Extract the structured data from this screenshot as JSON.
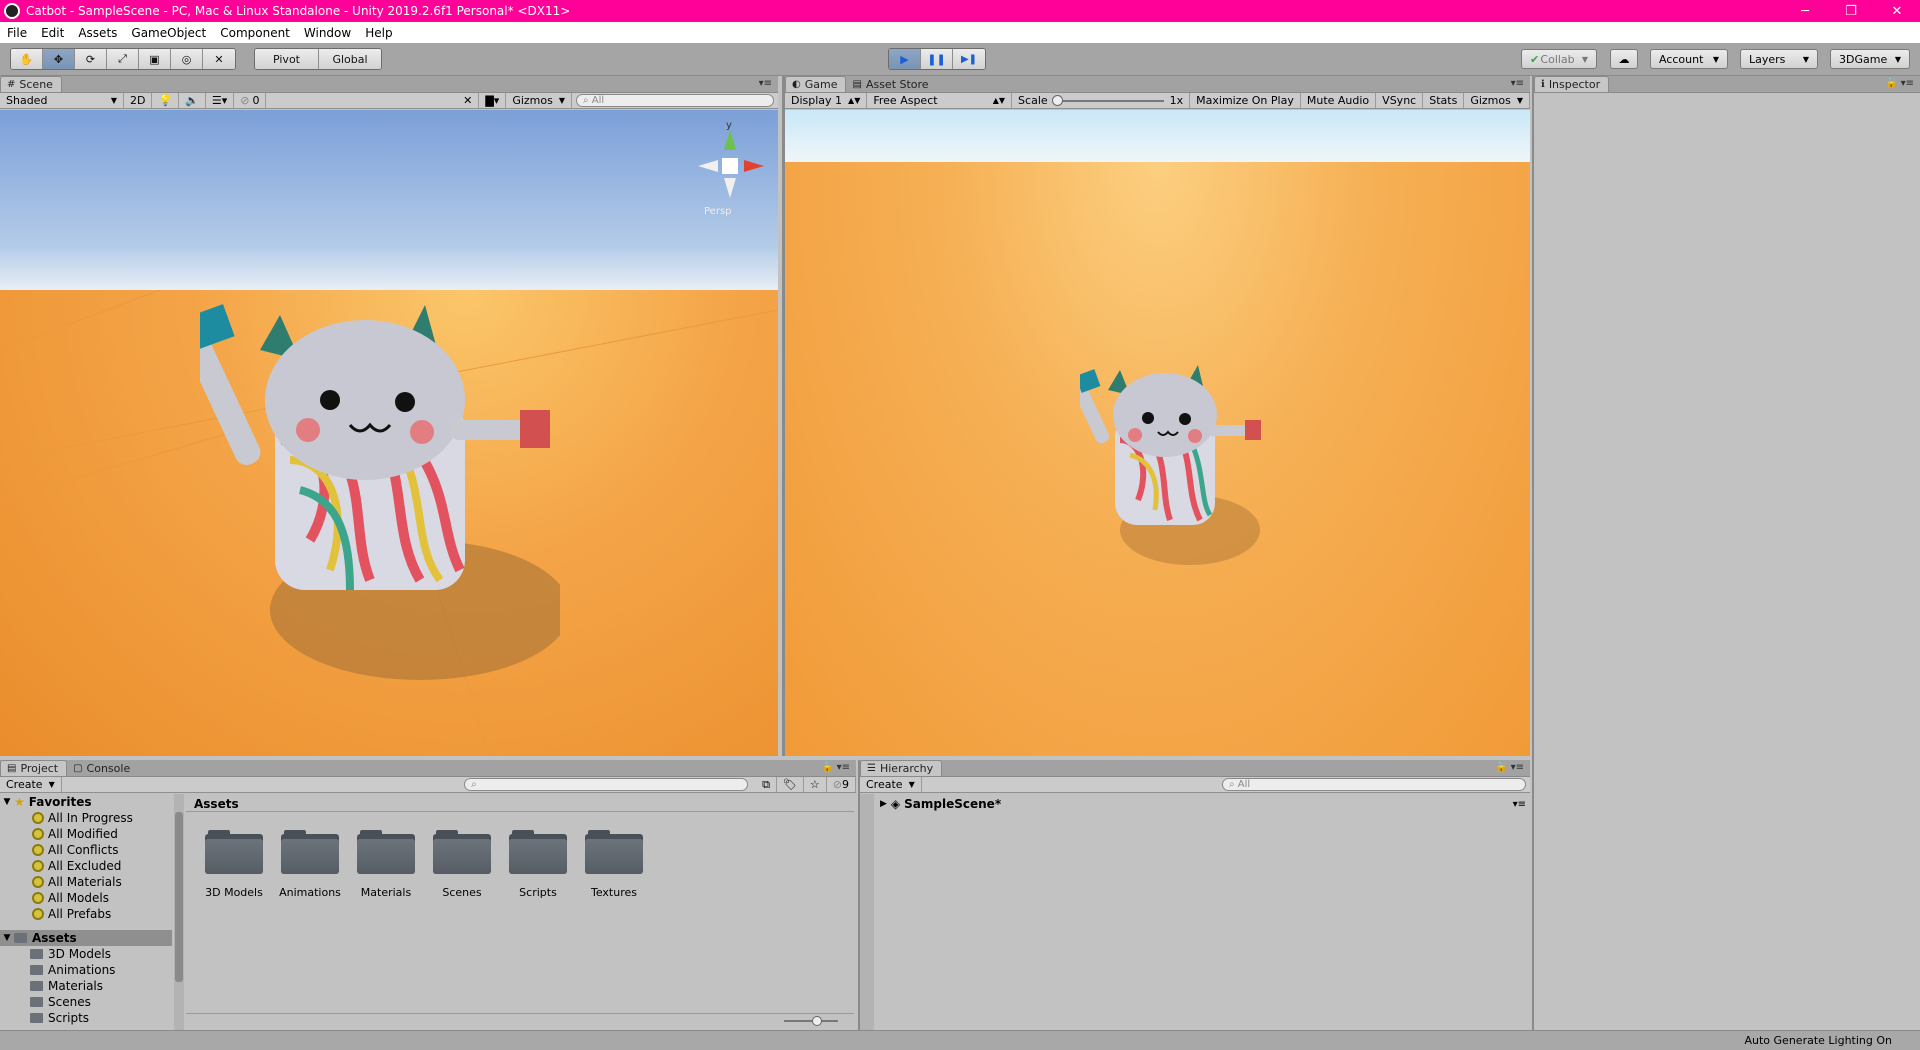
{
  "window": {
    "title": "Catbot - SampleScene - PC, Mac & Linux Standalone - Unity 2019.2.6f1 Personal* <DX11>",
    "minimize_glyph": "─",
    "restore_glyph": "❐",
    "close_glyph": "✕"
  },
  "menu": [
    "File",
    "Edit",
    "Assets",
    "GameObject",
    "Component",
    "Window",
    "Help"
  ],
  "toolbar": {
    "tools": [
      {
        "name": "hand-tool",
        "glyph": "✋"
      },
      {
        "name": "move-tool",
        "glyph": "✥"
      },
      {
        "name": "rotate-tool",
        "glyph": "⟳"
      },
      {
        "name": "scale-tool",
        "glyph": "⤢"
      },
      {
        "name": "rect-tool",
        "glyph": "▣"
      },
      {
        "name": "transform-tool",
        "glyph": "◎"
      },
      {
        "name": "custom-tool",
        "glyph": "✕"
      }
    ],
    "pivot_label": "Pivot",
    "global_label": "Global",
    "play_glyph": "▶",
    "pause_glyph": "❚❚",
    "step_glyph": "▶❚",
    "collab_label": "Collab",
    "cloud_glyph": "☁",
    "account_label": "Account",
    "layers_label": "Layers",
    "layout_label": "3DGame",
    "play_active": true
  },
  "scene_panel": {
    "tab_label": "Scene",
    "shading_mode": "Shaded",
    "mode_2d": "2D",
    "hidden_count": "0",
    "gizmos_label": "Gizmos",
    "search_placeholder": "All",
    "persp_label": "Persp",
    "axis_y": "y"
  },
  "game_panel": {
    "tab_label": "Game",
    "asset_store_label": "Asset Store",
    "display": "Display 1",
    "aspect": "Free Aspect",
    "scale_label": "Scale",
    "scale_value": "1x",
    "maximize_label": "Maximize On Play",
    "mute_label": "Mute Audio",
    "vsync_label": "VSync",
    "stats_label": "Stats",
    "gizmos_label": "Gizmos"
  },
  "inspector": {
    "tab_label": "Inspector"
  },
  "project_panel": {
    "tab_label": "Project",
    "console_label": "Console",
    "create_label": "Create",
    "hidden_count": "9",
    "breadcrumb": "Assets",
    "favorites_label": "Favorites",
    "favorites": [
      "All In Progress",
      "All Modified",
      "All Conflicts",
      "All Excluded",
      "All Materials",
      "All Models",
      "All Prefabs"
    ],
    "assets_label": "Assets",
    "tree_folders": [
      "3D Models",
      "Animations",
      "Materials",
      "Scenes",
      "Scripts"
    ],
    "grid_folders": [
      "3D Models",
      "Animations",
      "Materials",
      "Scenes",
      "Scripts",
      "Textures"
    ]
  },
  "hierarchy_panel": {
    "tab_label": "Hierarchy",
    "create_label": "Create",
    "search_placeholder": "All",
    "scene_name": "SampleScene*"
  },
  "status": {
    "text": "Auto Generate Lighting On"
  }
}
